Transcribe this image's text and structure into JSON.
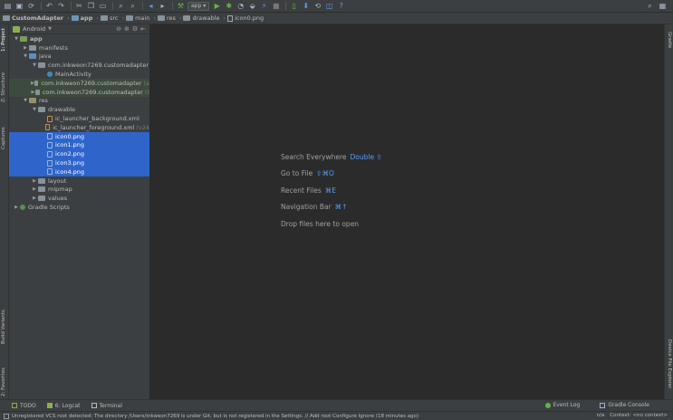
{
  "toolbar": {
    "run_config": "app",
    "icons": [
      "open-icon",
      "save-icon",
      "sync-icon",
      "undo-icon",
      "redo-icon",
      "cut-icon",
      "copy-icon",
      "paste-icon",
      "find-icon",
      "replace-icon",
      "back-icon",
      "forward-icon",
      "build-icon",
      "run-icon",
      "debug-icon",
      "profile-icon",
      "attach-icon",
      "apply-changes-icon",
      "stop-icon",
      "avd-icon",
      "sdk-icon",
      "sync-gradle-icon",
      "layout-inspector-icon",
      "help-icon"
    ]
  },
  "breadcrumbs": [
    {
      "label": "CustomAdapter",
      "bold": true
    },
    {
      "label": "app",
      "bold": true
    },
    {
      "label": "src"
    },
    {
      "label": "main"
    },
    {
      "label": "res"
    },
    {
      "label": "drawable"
    },
    {
      "label": "icon0.png"
    }
  ],
  "left_tabs": {
    "project": "1: Project",
    "structure": "Z: Structure",
    "captures": "Captures",
    "build_variants": "Build Variants",
    "favorites": "2: Favorites"
  },
  "right_tabs": {
    "gradle": "Gradle",
    "device_file_explorer": "Device File Explorer"
  },
  "project_panel": {
    "mode": "Android",
    "tree": [
      {
        "label": "app",
        "depth": 0,
        "expanded": true,
        "icon": "mod",
        "bold": true
      },
      {
        "label": "manifests",
        "depth": 1,
        "expanded": false,
        "icon": "folder"
      },
      {
        "label": "java",
        "depth": 1,
        "expanded": true,
        "icon": "src"
      },
      {
        "label": "com.inkweon7269.customadapter",
        "depth": 2,
        "expanded": true,
        "icon": "pkg"
      },
      {
        "label": "MainActivity",
        "depth": 3,
        "icon": "cls"
      },
      {
        "label": "com.inkweon7269.customadapter",
        "suffix": "(a",
        "depth": 2,
        "expanded": false,
        "icon": "pkg",
        "hl": true
      },
      {
        "label": "com.inkweon7269.customadapter",
        "suffix": "(t",
        "depth": 2,
        "expanded": false,
        "icon": "pkg",
        "hl": true
      },
      {
        "label": "res",
        "depth": 1,
        "expanded": true,
        "icon": "res-folder"
      },
      {
        "label": "drawable",
        "depth": 2,
        "expanded": true,
        "icon": "folder"
      },
      {
        "label": "ic_launcher_background.xml",
        "depth": 3,
        "icon": "xml"
      },
      {
        "label": "ic_launcher_foreground.xml",
        "suffix": "(v24",
        "depth": 3,
        "icon": "xml"
      },
      {
        "label": "icon0.png",
        "depth": 3,
        "icon": "png",
        "sel": true
      },
      {
        "label": "icon1.png",
        "depth": 3,
        "icon": "png",
        "sel": true
      },
      {
        "label": "icon2.png",
        "depth": 3,
        "icon": "png",
        "sel": true
      },
      {
        "label": "icon3.png",
        "depth": 3,
        "icon": "png",
        "sel": true
      },
      {
        "label": "icon4.png",
        "depth": 3,
        "icon": "png",
        "sel": true
      },
      {
        "label": "layout",
        "depth": 2,
        "expanded": false,
        "icon": "folder"
      },
      {
        "label": "mipmap",
        "depth": 2,
        "expanded": false,
        "icon": "folder"
      },
      {
        "label": "values",
        "depth": 2,
        "expanded": false,
        "icon": "folder"
      },
      {
        "label": "Gradle Scripts",
        "depth": 0,
        "expanded": false,
        "icon": "gradle"
      }
    ]
  },
  "editor": {
    "hints": [
      {
        "label": "Search Everywhere",
        "shortcut": "Double ⇧"
      },
      {
        "label": "Go to File",
        "shortcut": "⇧⌘O"
      },
      {
        "label": "Recent Files",
        "shortcut": "⌘E"
      },
      {
        "label": "Navigation Bar",
        "shortcut": "⌘↑"
      },
      {
        "label": "Drop files here to open",
        "shortcut": ""
      }
    ]
  },
  "bottom_tabs": {
    "todo": "TODO",
    "logcat": "6: Logcat",
    "terminal": "Terminal",
    "event_log": "Event Log",
    "gradle_console": "Gradle Console"
  },
  "status": {
    "message": "Unregistered VCS root detected: The directory /Users/inkweon7269 is under Git, but is not registered in the Settings. // Add root  Configure  Ignore (18 minutes ago)",
    "position": "n/a",
    "context": "Context: <no context>"
  }
}
